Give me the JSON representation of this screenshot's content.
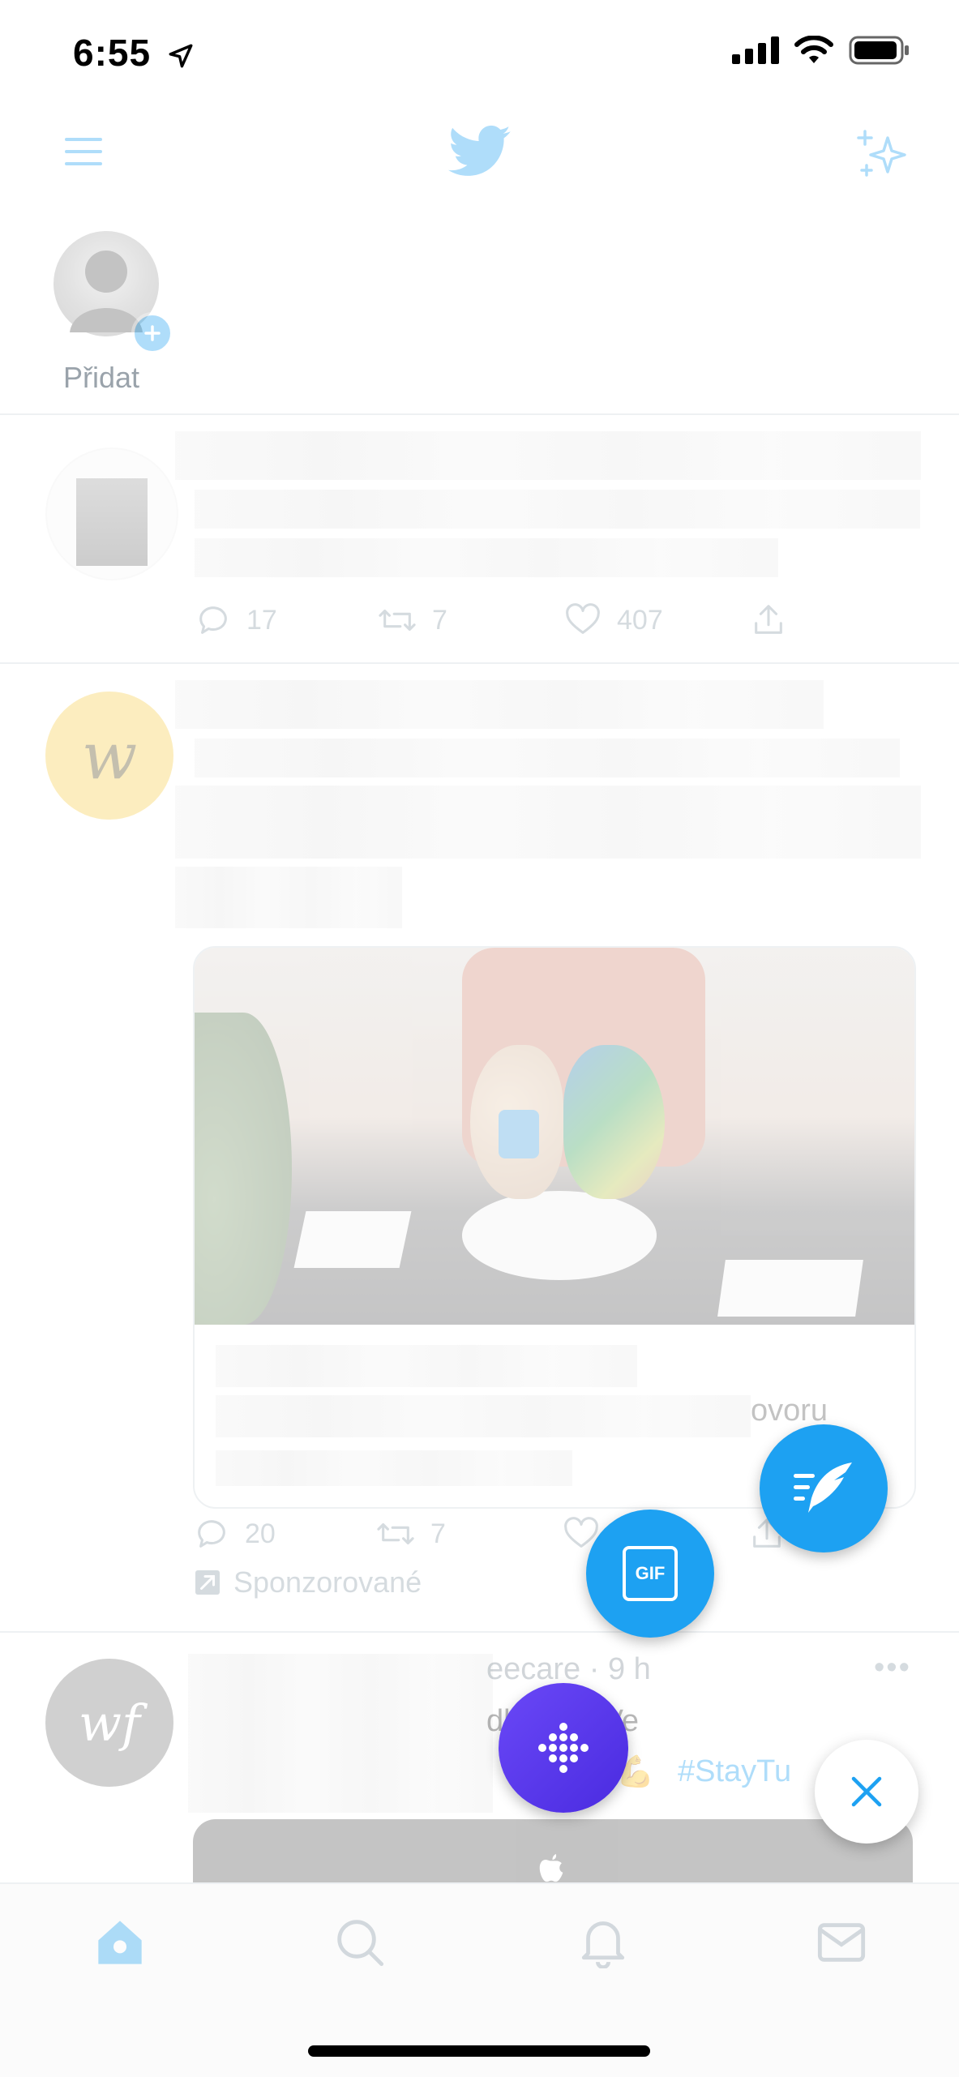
{
  "status_bar": {
    "time": "6:55"
  },
  "stories": {
    "add_label": "Přidat"
  },
  "tweet1": {
    "replies": "17",
    "retweets": "7",
    "likes": "407"
  },
  "tweet2": {
    "link_fragment": "ovoru",
    "replies": "20",
    "retweets": "7",
    "sponsored": "Sponzorované"
  },
  "tweet3": {
    "meta_fragment": "eecare · 9 h",
    "text_fragment": "dlinéhо. Ve",
    "hashtag": "#StayTu"
  },
  "fab": {
    "gif_label": "GIF"
  },
  "colors": {
    "twitter_blue": "#1DA1F2",
    "purple": "#5B3BF5"
  }
}
